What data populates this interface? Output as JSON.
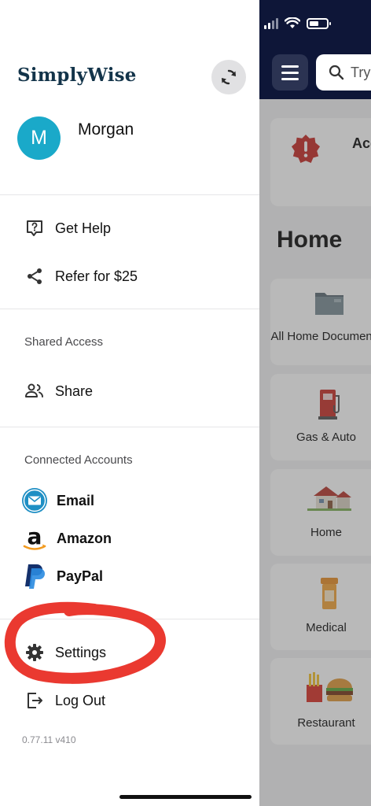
{
  "drawer": {
    "brand": "SimplyWise",
    "user": {
      "initial": "M",
      "name": "Morgan"
    },
    "help_items": [
      {
        "label": "Get Help",
        "icon": "help-question-icon"
      },
      {
        "label": "Refer for $25",
        "icon": "share-icon"
      }
    ],
    "shared_access": {
      "title": "Shared Access",
      "share_label": "Share"
    },
    "connected_accounts": {
      "title": "Connected Accounts",
      "items": [
        {
          "label": "Email",
          "icon": "email-icon"
        },
        {
          "label": "Amazon",
          "icon": "amazon-icon"
        },
        {
          "label": "PayPal",
          "icon": "paypal-icon"
        }
      ]
    },
    "settings_label": "Settings",
    "logout_label": "Log Out",
    "version": "0.77.11 v410"
  },
  "background_app": {
    "search_placeholder": "Try",
    "alert_text": "Acc",
    "section_title": "Home",
    "tiles": [
      {
        "label": "All Home Documents",
        "icon": "folder-icon"
      },
      {
        "label": "Gas & Auto",
        "icon": "gas-pump-icon"
      },
      {
        "label": "Home",
        "icon": "house-icon"
      },
      {
        "label": "Medical",
        "icon": "pill-bottle-icon"
      },
      {
        "label": "Restaurant",
        "icon": "burger-fries-icon"
      }
    ]
  },
  "colors": {
    "brand": "#13344a",
    "avatar": "#1aa9c9",
    "topbar": "#0e1638",
    "accent_pill": "#2fa3b7",
    "annotation": "#e8281e"
  }
}
